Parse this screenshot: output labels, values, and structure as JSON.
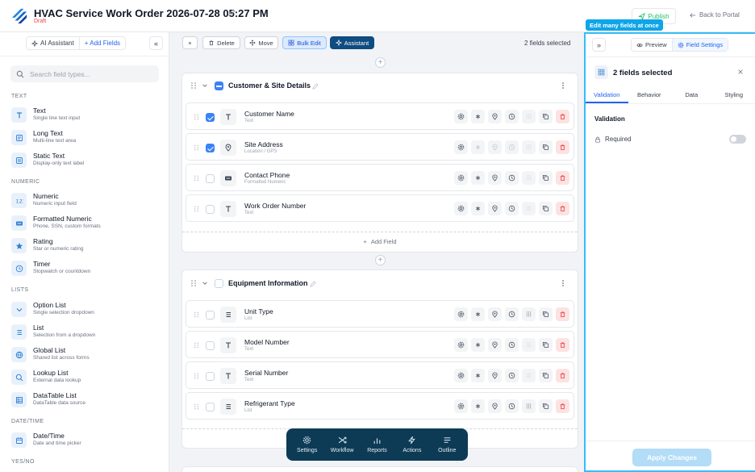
{
  "header": {
    "title": "HVAC Service Work Order 2026-07-28 05:27 PM",
    "status": "Draft",
    "publish_label": "Publish",
    "back_label": "Back to Portal"
  },
  "sidebar": {
    "tab_assistant": "AI Assistant",
    "tab_add_fields": "+ Add Fields",
    "collapse_label": "«",
    "search_placeholder": "Search field types...",
    "categories": {
      "text": "TEXT",
      "numeric": "NUMERIC",
      "lists": "LISTS",
      "datetime": "DATE/TIME",
      "yesno": "YES/NO"
    },
    "items": [
      {
        "name": "Text",
        "desc": "Single line text input",
        "icon": "text-icon"
      },
      {
        "name": "Long Text",
        "desc": "Multi-line text area",
        "icon": "long-text-icon"
      },
      {
        "name": "Static Text",
        "desc": "Display-only text label",
        "icon": "static-text-icon"
      },
      {
        "name": "Numeric",
        "desc": "Numeric input field",
        "icon": "numeric-icon"
      },
      {
        "name": "Formatted Numeric",
        "desc": "Phone, SSN, custom formats",
        "icon": "formatted-numeric-icon"
      },
      {
        "name": "Rating",
        "desc": "Star or numeric rating",
        "icon": "star-icon"
      },
      {
        "name": "Timer",
        "desc": "Stopwatch or countdown",
        "icon": "timer-icon"
      },
      {
        "name": "Option List",
        "desc": "Single selection dropdown",
        "icon": "chevron-down-icon"
      },
      {
        "name": "List",
        "desc": "Selection from a dropdown",
        "icon": "list-icon"
      },
      {
        "name": "Global List",
        "desc": "Shared list across forms",
        "icon": "globe-icon"
      },
      {
        "name": "Lookup List",
        "desc": "External data lookup",
        "icon": "search-icon"
      },
      {
        "name": "DataTable List",
        "desc": "DataTable data source",
        "icon": "table-icon"
      },
      {
        "name": "Date/Time",
        "desc": "Date and time picker",
        "icon": "calendar-icon"
      }
    ]
  },
  "toolbar": {
    "close_label": "×",
    "delete_label": "Delete",
    "move_label": "Move",
    "bulk_edit_label": "Bulk Edit",
    "assistant_label": "Assistant",
    "selected_count": "2 fields selected"
  },
  "sections": [
    {
      "title": "Customer & Site Details",
      "fields": [
        {
          "name": "Customer Name",
          "type": "Text",
          "checked": true
        },
        {
          "name": "Site Address",
          "type": "Location / GPS",
          "checked": true
        },
        {
          "name": "Contact Phone",
          "type": "Formatted Numeric",
          "checked": false
        },
        {
          "name": "Work Order Number",
          "type": "Text",
          "checked": false
        }
      ],
      "add_label": "Add Field"
    },
    {
      "title": "Equipment Information",
      "fields": [
        {
          "name": "Unit Type",
          "type": "List",
          "checked": false
        },
        {
          "name": "Model Number",
          "type": "Text",
          "checked": false
        },
        {
          "name": "Serial Number",
          "type": "Text",
          "checked": false
        },
        {
          "name": "Refrigerant Type",
          "type": "List",
          "checked": false
        }
      ]
    }
  ],
  "dock": [
    {
      "label": "Settings",
      "icon": "gear-icon"
    },
    {
      "label": "Workflow",
      "icon": "shuffle-icon"
    },
    {
      "label": "Reports",
      "icon": "bar-chart-icon"
    },
    {
      "label": "Actions",
      "icon": "lightning-icon"
    },
    {
      "label": "Outline",
      "icon": "outline-icon"
    }
  ],
  "right_panel": {
    "tooltip": "Edit many fields at once",
    "expand_label": "»",
    "preview_tab": "Preview",
    "field_settings_tab": "Field Settings",
    "heading": "2 fields selected",
    "subtabs": [
      "Validation",
      "Behavior",
      "Data",
      "Styling"
    ],
    "section_title": "Validation",
    "required_label": "Required",
    "apply_label": "Apply Changes"
  },
  "colors": {
    "accent": "#2563eb",
    "brand": "#0f4c81",
    "dock": "#0d3b56",
    "delete": "#e23b3b",
    "publish": "#22c55e",
    "draft": "#ef4444"
  }
}
